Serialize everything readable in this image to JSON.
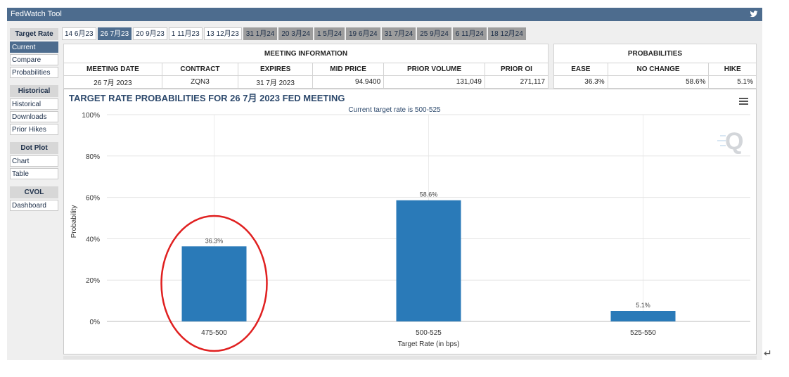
{
  "app": {
    "title": "FedWatch Tool",
    "brand_color": "#4d6c8e",
    "share_icon": "twitter-bird-icon"
  },
  "sidebar": {
    "sections": [
      {
        "header": "Target Rate",
        "items": [
          {
            "label": "Current",
            "active": true
          },
          {
            "label": "Compare",
            "active": false
          },
          {
            "label": "Probabilities",
            "active": false
          }
        ]
      },
      {
        "header": "Historical",
        "items": [
          {
            "label": "Historical",
            "active": false
          },
          {
            "label": "Downloads",
            "active": false
          },
          {
            "label": "Prior Hikes",
            "active": false
          }
        ]
      },
      {
        "header": "Dot Plot",
        "items": [
          {
            "label": "Chart",
            "active": false
          },
          {
            "label": "Table",
            "active": false
          }
        ]
      },
      {
        "header": "CVOL",
        "items": [
          {
            "label": "Dashboard",
            "active": false
          }
        ]
      }
    ]
  },
  "meeting_tabs": [
    {
      "label": "14 6月23",
      "state": "past"
    },
    {
      "label": "26 7月23",
      "state": "active"
    },
    {
      "label": "20 9月23",
      "state": "past"
    },
    {
      "label": "1 11月23",
      "state": "past"
    },
    {
      "label": "13 12月23",
      "state": "past"
    },
    {
      "label": "31 1月24",
      "state": "future"
    },
    {
      "label": "20 3月24",
      "state": "future"
    },
    {
      "label": "1 5月24",
      "state": "future"
    },
    {
      "label": "19 6月24",
      "state": "future"
    },
    {
      "label": "31 7月24",
      "state": "future"
    },
    {
      "label": "25 9月24",
      "state": "future"
    },
    {
      "label": "6 11月24",
      "state": "future"
    },
    {
      "label": "18 12月24",
      "state": "future"
    }
  ],
  "meeting_info": {
    "caption": "MEETING INFORMATION",
    "headers": [
      "MEETING DATE",
      "CONTRACT",
      "EXPIRES",
      "MID PRICE",
      "PRIOR VOLUME",
      "PRIOR OI"
    ],
    "row": [
      "26 7月 2023",
      "ZQN3",
      "31 7月 2023",
      "94.9400",
      "131,049",
      "271,117"
    ]
  },
  "probabilities": {
    "caption": "PROBABILITIES",
    "headers": [
      "EASE",
      "NO CHANGE",
      "HIKE"
    ],
    "row": [
      "36.3%",
      "58.6%",
      "5.1%"
    ]
  },
  "chart_title": "TARGET RATE PROBABILITIES FOR 26 7月 2023 FED MEETING",
  "chart_subtitle": "Current target rate is 500-525",
  "chart_menu_icon": "hamburger-menu-icon",
  "watermark_icon": "quikstrike-q-logo-icon",
  "chart_data": {
    "type": "bar",
    "categories": [
      "475-500",
      "500-525",
      "525-550"
    ],
    "values": [
      36.3,
      58.6,
      5.1
    ],
    "data_labels": [
      "36.3%",
      "58.6%",
      "5.1%"
    ],
    "xlabel": "Target Rate (in bps)",
    "ylabel": "Probability",
    "ylim": [
      0,
      100
    ],
    "yticks": [
      "0%",
      "20%",
      "40%",
      "60%",
      "80%",
      "100%"
    ],
    "bar_color": "#2a7ab8",
    "annotation": {
      "type": "circle",
      "target": "475-500",
      "color": "#e02020"
    }
  },
  "return_glyph": "↵"
}
